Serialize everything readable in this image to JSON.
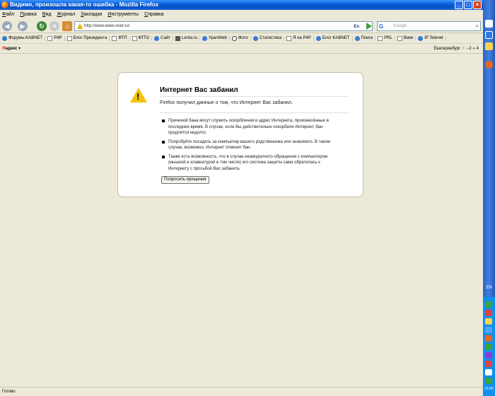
{
  "window": {
    "title": "Видимо, произошла какая-то ошибка - Mozilla Firefox",
    "controls": [
      "_",
      "□",
      "×"
    ]
  },
  "menu": [
    "Файл",
    "Правка",
    "Вид",
    "Журнал",
    "Закладки",
    "Инструменты",
    "Справка"
  ],
  "nav": {
    "url": "http://www.www-over.ru/",
    "lang_indicator": "En",
    "search_placeholder": "Google",
    "search_engine_glyph": "G"
  },
  "bookmarks": [
    "Форумы.KABNET",
    "P4P",
    "Блог Президента",
    "ФТП",
    "ФТП2",
    "Сайт",
    "Lenta.ru",
    "УралWeb",
    "Фото",
    "Статистика",
    "Я на P4P",
    "Блог KABNET",
    "Поиск",
    "PRL",
    "Вики",
    "IP Telenet"
  ],
  "yandex": {
    "logo_first": "Я",
    "logo_rest": "ндекс",
    "city": "Екатеринбург",
    "temperature": "−2",
    "traffic": "4"
  },
  "error": {
    "title": "Интернет Вас забанил",
    "description": "Firefox получил данные о том, что Интернет Вас забанил.",
    "items": [
      "Причиной бана могут служить оскорбления в адрес Интернета, произнесённые в последнее время. В случае, если Вы действительно оскорбили Интернет, бан продлится недолго.",
      "Попробуйте посадить за компьютер вашего родственника или знакомого. В таком случае, возможно, Интернет отменит бан.",
      "Также есть возможность, что в случае неаккуратного обращения с компьютером (мышкой и клавиатурой в том числе) его система защиты сама обратилась к Интернету с просьбой Вас забанить."
    ],
    "button_label": "Попросить прощения"
  },
  "status": "Готово",
  "taskbar": {
    "language": "EN",
    "clock": "21:05"
  }
}
